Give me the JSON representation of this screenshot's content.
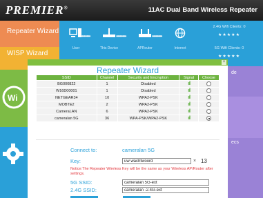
{
  "header": {
    "logo": "PREMIER",
    "logo_mark": "®",
    "title": "11AC Dual Band Wireless Repeater"
  },
  "tiles": {
    "repeater_wizard": "Repeater Wizard",
    "wisp_wizard": "WISP Wizard",
    "wifi_icon": "wifi-icon",
    "gear_icon": "gear-icon"
  },
  "topology": {
    "user": "User",
    "this_device": "This Device",
    "ap_router": "APRouter",
    "internet": "Internet",
    "dots": "••••••••"
  },
  "status_panel": {
    "wifi24_label": "2.4G Wifi Clients:",
    "wifi24_count": "0",
    "wifi5_label": "5G Wifi Clients:",
    "wifi5_count": "0",
    "stars": "★★★★★"
  },
  "right_fragments": {
    "frag1": "de",
    "frag2": "ecs"
  },
  "modal": {
    "title": "Repeater Wizard",
    "close": "×",
    "columns": [
      "SSID",
      "Channel",
      "Security and Encryption",
      "Signal",
      "Choose"
    ],
    "rows": [
      {
        "ssid": "BG000822",
        "channel": "1",
        "security": "Disabled",
        "signal": "ııll",
        "selected": false
      },
      {
        "ssid": "W16D00001",
        "channel": "1",
        "security": "Disabled",
        "signal": "ııll",
        "selected": false
      },
      {
        "ssid": "NETGEAR34",
        "channel": "10",
        "security": "WPA2-PSK",
        "signal": "ııll",
        "selected": false
      },
      {
        "ssid": "MOBTE2",
        "channel": "2",
        "security": "WPA2-PSK",
        "signal": "ııll",
        "selected": false
      },
      {
        "ssid": "CameraLAN",
        "channel": "6",
        "security": "WPA2-PSK",
        "signal": "ııll",
        "selected": false
      },
      {
        "ssid": "cameralan 5G",
        "channel": "36",
        "security": "WPA-PSK/WPA2-PSK",
        "signal": "ııll",
        "selected": true
      }
    ],
    "form": {
      "connect_label": "Connect to:",
      "connect_value": "cameralan 5G",
      "key_label": "Key:",
      "key_value": "uw wachtwoord",
      "key_clear": "×",
      "key_count": "13",
      "notice": "Notice:The Repeater Wireless Key will be the same as your Wireless AP/Router after settings.",
      "ssid5_label": "5G SSID:",
      "ssid5_value": "cameralan 5G-ext",
      "ssid24_label": "2.4G SSID:",
      "ssid24_value": "cameralan -2.4G-ext"
    }
  },
  "colors": {
    "accent_blue": "#2aa0d8",
    "green": "#7fbf3f",
    "orange": "#ee8b52",
    "yellow": "#f2b233",
    "purple": "#9a82d6",
    "notice_red": "#e2363c"
  }
}
